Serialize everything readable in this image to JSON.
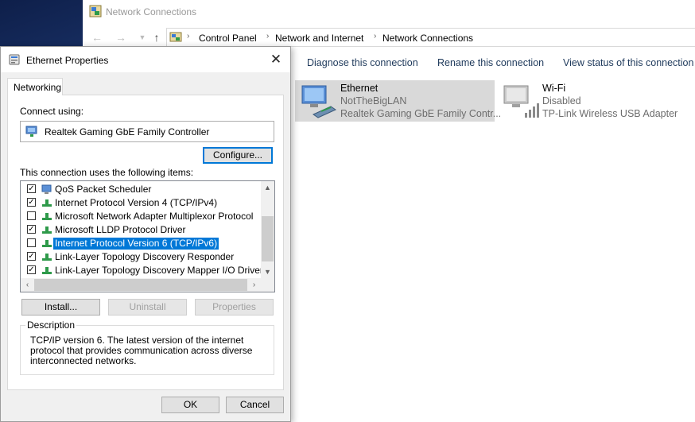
{
  "explorer": {
    "title": "Network Connections",
    "breadcrumb": [
      "Control Panel",
      "Network and Internet",
      "Network Connections"
    ],
    "commands": [
      "Diagnose this connection",
      "Rename this connection",
      "View status of this connection"
    ],
    "connections": [
      {
        "name": "Ethernet",
        "status": "NotTheBigLAN",
        "device": "Realtek Gaming GbE Family Contr..."
      },
      {
        "name": "Wi-Fi",
        "status": "Disabled",
        "device": "TP-Link Wireless USB Adapter"
      }
    ]
  },
  "dialog": {
    "title": "Ethernet Properties",
    "close_glyph": "✕",
    "tab": "Networking",
    "connect_using_label": "Connect using:",
    "adapter": "Realtek Gaming GbE Family Controller",
    "configure_button": "Configure...",
    "items_label": "This connection uses the following items:",
    "items": [
      {
        "label": "QoS Packet Scheduler",
        "checked": true
      },
      {
        "label": "Internet Protocol Version 4 (TCP/IPv4)",
        "checked": true
      },
      {
        "label": "Microsoft Network Adapter Multiplexor Protocol",
        "checked": false
      },
      {
        "label": "Microsoft LLDP Protocol Driver",
        "checked": true
      },
      {
        "label": "Internet Protocol Version 6 (TCP/IPv6)",
        "checked": false,
        "selected": true
      },
      {
        "label": "Link-Layer Topology Discovery Responder",
        "checked": true
      },
      {
        "label": "Link-Layer Topology Discovery Mapper I/O Driver",
        "checked": true
      }
    ],
    "install_button": "Install...",
    "uninstall_button": "Uninstall",
    "properties_button": "Properties",
    "description_legend": "Description",
    "description_text": "TCP/IP version 6. The latest version of the internet protocol that provides communication across diverse interconnected networks.",
    "ok_button": "OK",
    "cancel_button": "Cancel"
  },
  "colors": {
    "accent": "#0078d7",
    "command_text": "#1e395b",
    "selected_item_bg": "#d9d9d9",
    "desktop": "#1b3366"
  }
}
